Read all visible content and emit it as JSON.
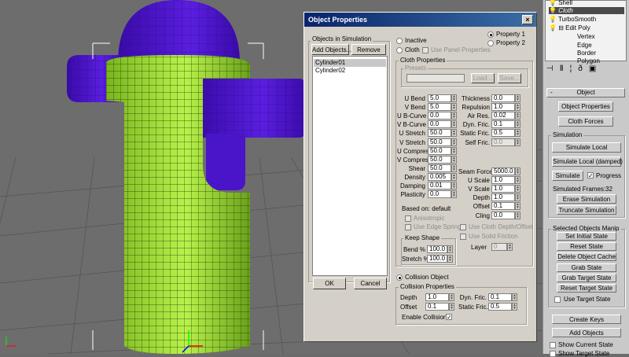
{
  "dialog": {
    "title": "Object Properties",
    "close_glyph": "×",
    "objects_group": "Objects in Simulation",
    "add_objects": "Add Objects...",
    "remove": "Remove",
    "objects": [
      "Cylinder01",
      "Cylinder02"
    ],
    "ok": "OK",
    "cancel": "Cancel",
    "mode": {
      "inactive": "Inactive",
      "cloth": "Cloth",
      "use_panel": "Use Panel Properties",
      "property1": "Property 1",
      "property2": "Property 2"
    },
    "cloth_props": {
      "title": "Cloth Properties",
      "presets": {
        "title": "Presets",
        "load": "Load...",
        "save": "Save..."
      },
      "left": [
        {
          "label": "U Bend",
          "value": "5.0"
        },
        {
          "label": "V Bend",
          "value": "5.0"
        },
        {
          "label": "U B-Curve",
          "value": "0.0"
        },
        {
          "label": "V B-Curve",
          "value": "0.0"
        },
        {
          "label": "U Stretch",
          "value": "50.0"
        },
        {
          "label": "V Stretch",
          "value": "50.0"
        },
        {
          "label": "U Compress",
          "value": "50.0"
        },
        {
          "label": "V Compress",
          "value": "50.0"
        },
        {
          "label": "Shear",
          "value": "50.0"
        },
        {
          "label": "Density",
          "value": "0.005"
        },
        {
          "label": "Damping",
          "value": "0.01"
        },
        {
          "label": "Plasticity",
          "value": "0.0"
        }
      ],
      "right": [
        {
          "label": "Thickness",
          "value": "0.0"
        },
        {
          "label": "Repulsion",
          "value": "1.0"
        },
        {
          "label": "Air Res.",
          "value": "0.02"
        },
        {
          "label": "Dyn. Fric.",
          "value": "0.1"
        },
        {
          "label": "Static Fric.",
          "value": "0.5"
        },
        {
          "label": "Self Fric.",
          "value": "0.0"
        }
      ],
      "right2": [
        {
          "label": "Seam Force",
          "value": "5000.0"
        },
        {
          "label": "U Scale",
          "value": "1.0"
        },
        {
          "label": "V Scale",
          "value": "1.0"
        },
        {
          "label": "Depth",
          "value": "1.0"
        },
        {
          "label": "Offset",
          "value": "0.1"
        },
        {
          "label": "Cling",
          "value": "0.0"
        }
      ],
      "based_on": "Based on: default",
      "anisotropic": "Anisotropic",
      "edge_springs": "Use Edge Springs",
      "cloth_depth": "Use Cloth Depth/Offset",
      "solid_friction": "Use Solid Friction",
      "layer_label": "Layer",
      "layer_value": "0",
      "keep_shape": {
        "title": "Keep Shape",
        "bend_label": "Bend %",
        "bend_value": "100.0",
        "stretch_label": "Stretch %",
        "stretch_value": "100.0"
      }
    },
    "collision": {
      "radio": "Collision Object",
      "title": "Collision Properties",
      "depth_label": "Depth",
      "depth_value": "1.0",
      "offset_label": "Offset",
      "offset_value": "0.1",
      "dyn_label": "Dyn. Fric.",
      "dyn_value": "0.1",
      "static_label": "Static Fric.",
      "static_value": "0.5",
      "enable": "Enable Collisions",
      "check": "✓"
    }
  },
  "panel": {
    "stack": [
      "Shell",
      "Cloth",
      "TurboSmooth",
      "Edit Poly"
    ],
    "subs": [
      "Vertex",
      "Edge",
      "Border",
      "Polygon"
    ],
    "toolbar_icons": [
      "pin-icon",
      "pipe-icon",
      "vertical-icon",
      "delete-icon",
      "configure-icon"
    ],
    "object_rollout": "Object",
    "rollout_minus": "-",
    "object_props": "Object Properties",
    "cloth_forces": "Cloth Forces",
    "simulation_title": "Simulation",
    "sim_local": "Simulate Local",
    "sim_local_damped": "Simulate Local (damped)",
    "simulate": "Simulate",
    "progress": "Progress",
    "sim_frames_label": "Simulated Frames:",
    "sim_frames_value": "32",
    "erase": "Erase Simulation",
    "truncate": "Truncate Simulation",
    "selected_title": "Selected Objects Manip",
    "set_initial": "Set Initial State",
    "reset_state": "Reset State",
    "delete_cache": "Delete Object Cache",
    "grab_state": "Grab State",
    "grab_target": "Grab Target State",
    "reset_target": "Reset Target State",
    "use_target": "Use Target State",
    "create_keys": "Create Keys",
    "add_objects": "Add Objects",
    "show_current": "Show Current State",
    "show_target": "Show Target State"
  }
}
